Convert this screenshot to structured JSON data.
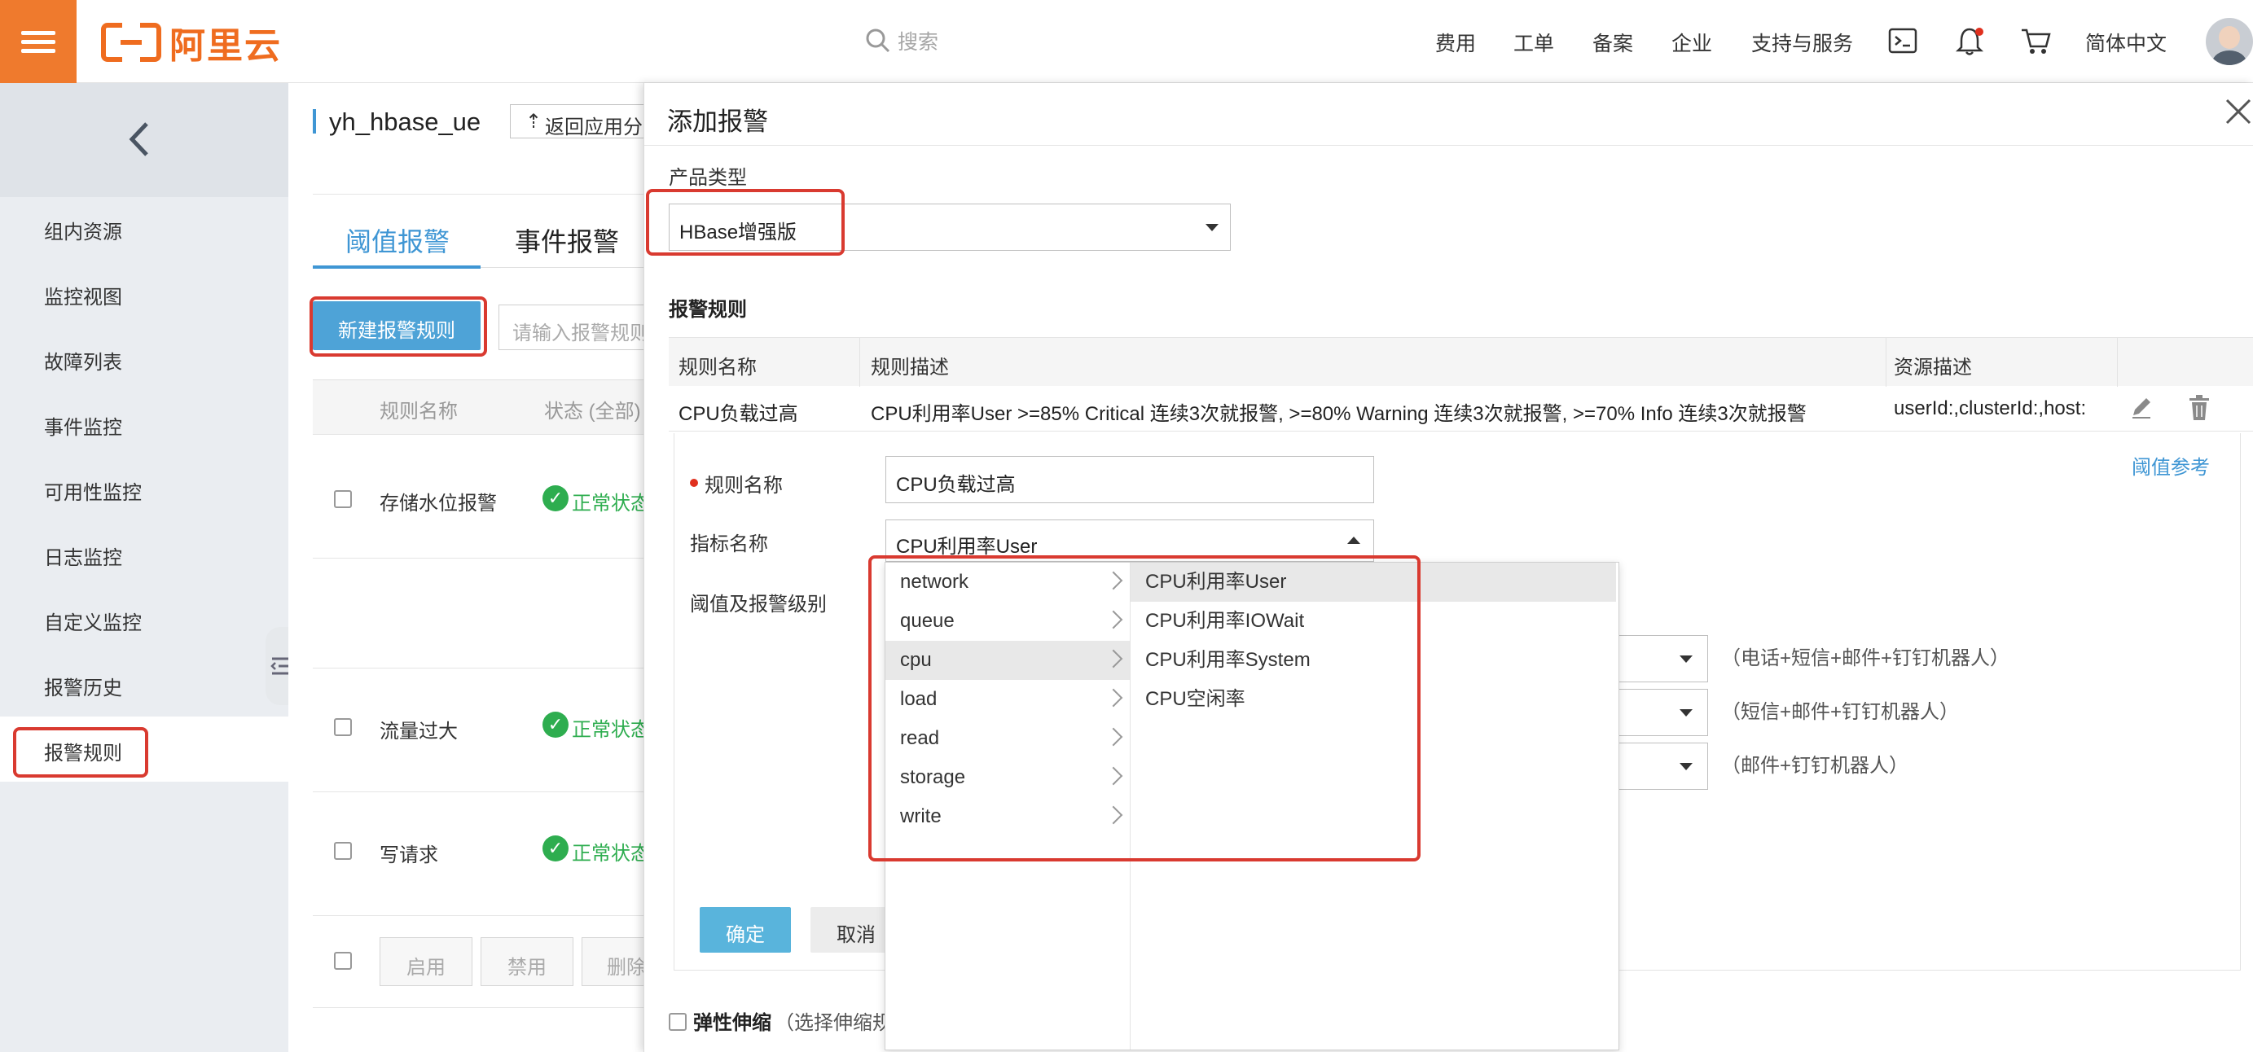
{
  "topbar": {
    "logo_text": "阿里云",
    "search_placeholder": "搜索",
    "nav": [
      "费用",
      "工单",
      "备案",
      "企业",
      "支持与服务"
    ],
    "language": "简体中文",
    "brand_color": "#ef7a2d"
  },
  "sidebar": {
    "items": [
      "组内资源",
      "监控视图",
      "故障列表",
      "事件监控",
      "可用性监控",
      "日志监控",
      "自定义监控",
      "报警历史",
      "报警规则"
    ],
    "active": "报警规则"
  },
  "page": {
    "group_name": "yh_hbase_ue",
    "back_button": "返回应用分",
    "tabs": [
      "阈值报警",
      "事件报警"
    ],
    "new_rule_button": "新建报警规则",
    "rule_search_placeholder": "请输入报警规则",
    "table_headers": [
      "规则名称",
      "状态 (全部)"
    ],
    "rows": [
      {
        "name": "存储水位报警",
        "status": "正常状态"
      },
      {
        "name": "流量过大",
        "status": "正常状态"
      },
      {
        "name": "写请求",
        "status": "正常状态"
      }
    ],
    "footer_buttons": [
      "启用",
      "禁用",
      "删除"
    ]
  },
  "drawer": {
    "title": "添加报警",
    "product_type_label": "产品类型",
    "product_type_value": "HBase增强版",
    "rules_section_label": "报警规则",
    "rules_table_headers": [
      "规则名称",
      "规则描述",
      "资源描述"
    ],
    "rule_row": {
      "name": "CPU负载过高",
      "description": "CPU利用率User >=85% Critical 连续3次就报警, >=80% Warning 连续3次就报警, >=70% Info 连续3次就报警",
      "resource": "userId:,clusterId:,host:"
    },
    "threshold_ref_link": "阈值参考",
    "form": {
      "rule_name_label": "规则名称",
      "rule_name_value": "CPU负载过高",
      "metric_label": "指标名称",
      "metric_value": "CPU利用率User",
      "threshold_label": "阈值及报警级别",
      "level_select_suffix": ")",
      "level_notes": [
        "（电话+短信+邮件+钉钉机器人）",
        "（短信+邮件+钉钉机器人）",
        "（邮件+钉钉机器人）"
      ],
      "confirm_button": "确定",
      "cancel_button": "取消"
    },
    "elastic_label": "弹性伸缩",
    "elastic_hint": "（选择伸缩规"
  },
  "metric_dropdown": {
    "categories": [
      "network",
      "queue",
      "cpu",
      "load",
      "read",
      "storage",
      "write"
    ],
    "selected_category": "cpu",
    "metrics": [
      "CPU利用率User",
      "CPU利用率IOWait",
      "CPU利用率System",
      "CPU空闲率"
    ],
    "selected_metric": "CPU利用率User"
  },
  "colors": {
    "accent_blue": "#3f96d4",
    "primary_button": "#4ea3d7",
    "confirm_button": "#59b4dc",
    "highlight_red": "#d93a30",
    "success_green": "#2ead4f"
  }
}
